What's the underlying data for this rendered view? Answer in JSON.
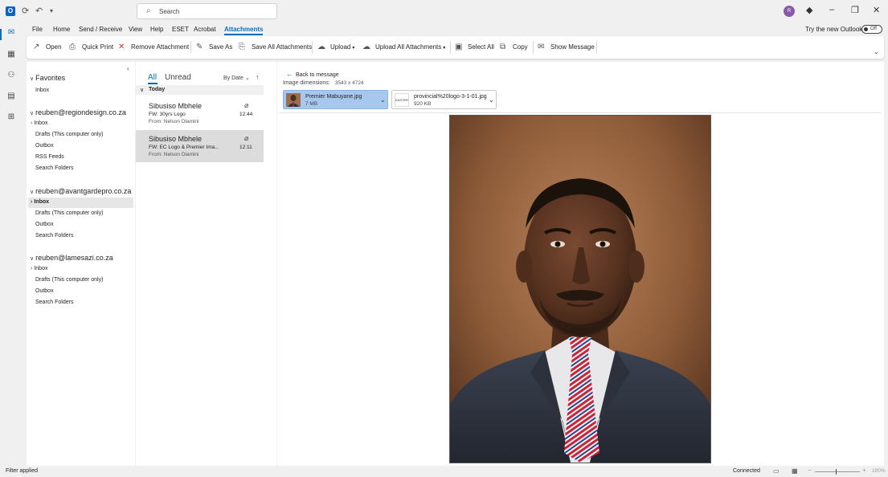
{
  "app": {
    "logo_letter": "O",
    "search_placeholder": "Search",
    "avatar_initial": "R"
  },
  "menu": {
    "tabs": [
      "File",
      "Home",
      "Send / Receive",
      "View",
      "Help",
      "ESET",
      "Acrobat",
      "Attachments"
    ],
    "active_tab": "Attachments",
    "try_new_outlook": "Try the new Outlook",
    "toggle_label": "Off"
  },
  "ribbon": {
    "open": "Open",
    "quick_print": "Quick Print",
    "remove_attachment": "Remove Attachment",
    "save_as": "Save As",
    "save_all": "Save All Attachments",
    "upload": "Upload",
    "upload_all": "Upload All Attachments",
    "select_all": "Select All",
    "copy": "Copy",
    "show_message": "Show Message"
  },
  "folders": {
    "favorites": {
      "label": "Favorites",
      "items": [
        "Inbox"
      ]
    },
    "accounts": [
      {
        "name": "reuben@regiondesign.co.za",
        "items": [
          "Inbox",
          "Drafts (This computer only)",
          "Outbox",
          "RSS Feeds",
          "Search Folders"
        ]
      },
      {
        "name": "reuben@avantgardepro.co.za",
        "items": [
          "Inbox",
          "Drafts (This computer only)",
          "Outbox",
          "Search Folders"
        ]
      },
      {
        "name": "reuben@lamesazi.co.za",
        "items": [
          "Inbox",
          "Drafts (This computer only)",
          "Outbox",
          "Search Folders"
        ]
      }
    ]
  },
  "message_list": {
    "filter_all": "All",
    "filter_unread": "Unread",
    "sort_label": "By Date",
    "group_label": "Today",
    "messages": [
      {
        "sender": "Sibusiso Mbhele",
        "subject": "FW: 30yrs Logo",
        "from": "From: Nelson Dlamini",
        "time": "12:44"
      },
      {
        "sender": "Sibusiso Mbhele",
        "subject": "FW: EC Logo & Premier Ima...",
        "from": "From: Nelson Dlamini",
        "time": "12:11"
      }
    ]
  },
  "reading_pane": {
    "back": "Back to message",
    "dims_label": "Image dimensions:",
    "dims_value": "3543 x 4724",
    "attachments": [
      {
        "name": "Premier Mabuyane.jpg",
        "size": "7 MB"
      },
      {
        "name": "provincial%20logo-3-1-01.jpg",
        "size": "920 KB"
      }
    ],
    "logo_thumb_text": "EASTERN"
  },
  "status": {
    "left": "Filter applied",
    "connection": "Connected",
    "zoom": "100%"
  },
  "colors": {
    "accent": "#0f6cbd",
    "selected_attachment": "#a8c7ef",
    "selected_message": "#dcdcdc"
  }
}
